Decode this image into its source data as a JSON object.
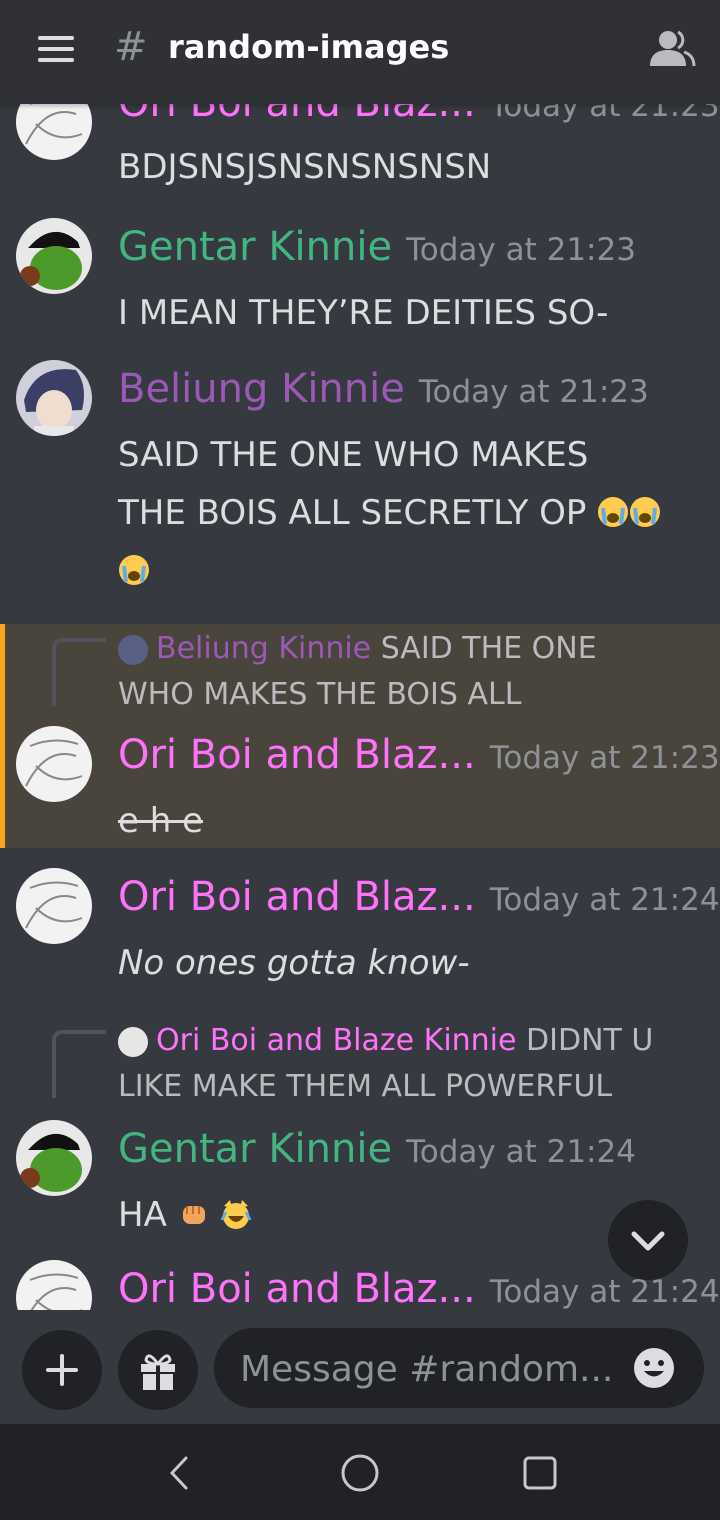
{
  "header": {
    "channel": "random-images",
    "hash": "#"
  },
  "messages": [
    {
      "author": "Ori Boi and Blaz...",
      "time": "Today at 21:23",
      "text": "BDJSNSJSNSNSNSNSN"
    },
    {
      "author": "Gentar Kinnie",
      "time": "Today at 21:23",
      "text": "I MEAN THEY’RE DEITIES SO-"
    },
    {
      "author": "Beliung Kinnie",
      "time": "Today at 21:23",
      "text_line1": "SAID THE ONE WHO MAKES",
      "text_line2": "THE BOIS ALL SECRETLY OP"
    },
    {
      "reply_author": "Beliung Kinnie",
      "reply_text_line1": "SAID THE ONE",
      "reply_text_line2": "WHO MAKES THE BOIS ALL",
      "author": "Ori Boi and Blaz...",
      "time": "Today at 21:23",
      "text": "e h e"
    },
    {
      "author": "Ori Boi and Blaz...",
      "time": "Today at 21:24",
      "text": "No ones gotta know-"
    },
    {
      "reply_author": "Ori Boi and Blaze Kinnie",
      "reply_text_line1": "DIDNT U",
      "reply_text_line2": "LIKE MAKE THEM ALL POWERFUL",
      "author": "Gentar Kinnie",
      "time": "Today at 21:24",
      "text": "HA"
    },
    {
      "author": "Ori Boi and Blaz...",
      "time": "Today at 21:24"
    }
  ],
  "composer": {
    "placeholder": "Message #random..."
  },
  "colors": {
    "pink": "#ff73fa",
    "green": "#43b581",
    "purple": "#9b59b6",
    "mention_bar": "#faa61a",
    "background": "#36393f"
  },
  "icons": [
    "hamburger-icon",
    "members-icon",
    "plus-icon",
    "gift-icon",
    "emoji-icon",
    "chevron-down-icon",
    "back-icon",
    "home-icon",
    "recents-icon"
  ]
}
